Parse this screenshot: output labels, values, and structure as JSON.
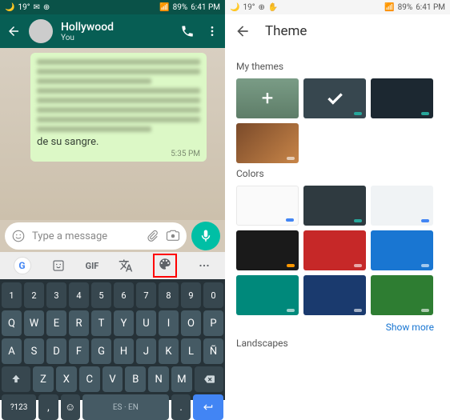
{
  "status": {
    "battery": "89%",
    "time": "6:41 PM",
    "temp": "19°"
  },
  "left": {
    "contact_name": "Hollywood",
    "contact_sub": "You",
    "bubble_text": "de su sangre.",
    "bubble_time": "5:35 PM",
    "input_placeholder": "Type a message"
  },
  "gboard": {
    "gif_label": "GIF"
  },
  "keyboard": {
    "nums": [
      "1",
      "2",
      "3",
      "4",
      "5",
      "6",
      "7",
      "8",
      "9",
      "0"
    ],
    "r1": [
      "Q",
      "W",
      "E",
      "R",
      "T",
      "Y",
      "U",
      "I",
      "O",
      "P"
    ],
    "r2": [
      "A",
      "S",
      "D",
      "F",
      "G",
      "H",
      "J",
      "K",
      "L",
      "Ñ"
    ],
    "r3_mid": [
      "Z",
      "X",
      "C",
      "V",
      "B",
      "N",
      "M"
    ],
    "sym": "?123",
    "lang": "ES · EN"
  },
  "right": {
    "title": "Theme",
    "section_mythemes": "My themes",
    "section_colors": "Colors",
    "section_landscapes": "Landscapes",
    "show_more": "Show more"
  }
}
